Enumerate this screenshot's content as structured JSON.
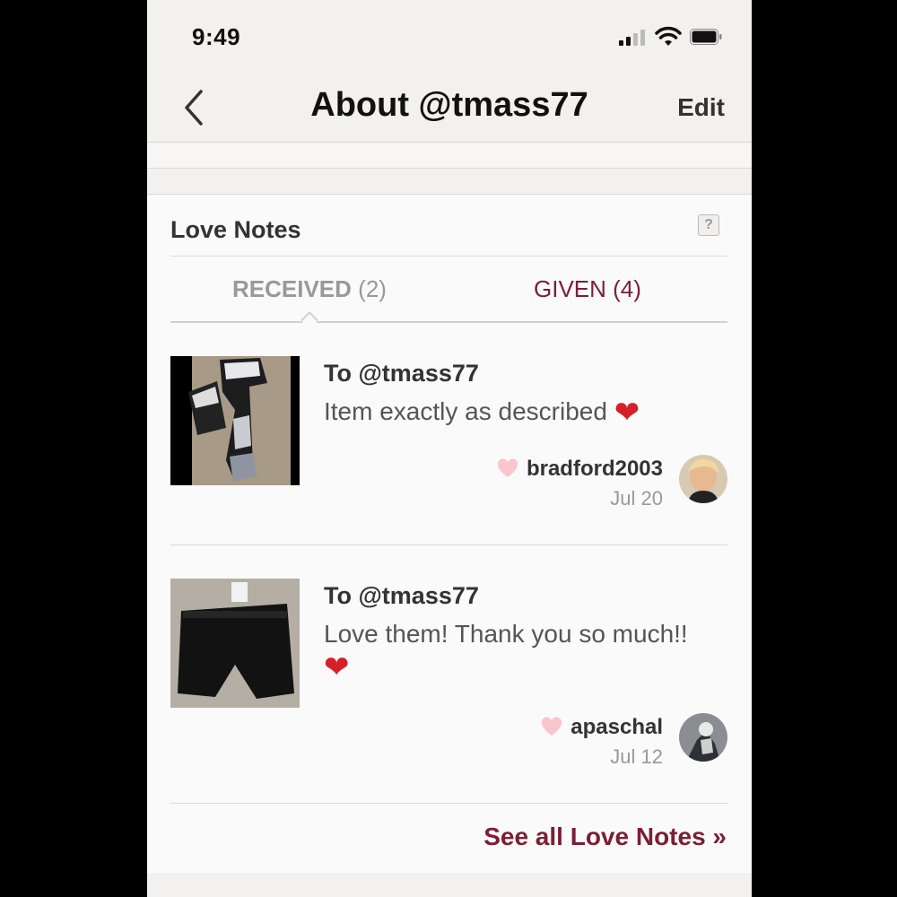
{
  "status_bar": {
    "time": "9:49"
  },
  "nav": {
    "title": "About @tmass77",
    "edit_label": "Edit"
  },
  "love_notes": {
    "title": "Love Notes",
    "help_label": "?",
    "tabs": [
      {
        "label": "RECEIVED",
        "count": "(2)"
      },
      {
        "label": "GIVEN (4)"
      }
    ],
    "notes": [
      {
        "to": "To @tmass77",
        "text": "Item exactly as described",
        "author": "bradford2003",
        "date": "Jul 20"
      },
      {
        "to": "To @tmass77",
        "text": "Love them! Thank you so much!!",
        "author": "apaschal",
        "date": "Jul 12"
      }
    ],
    "see_all_label": "See all Love Notes »"
  },
  "colors": {
    "accent": "#7b1f35",
    "heart_red": "#d5202a",
    "heart_pink": "#f8c6cc"
  }
}
